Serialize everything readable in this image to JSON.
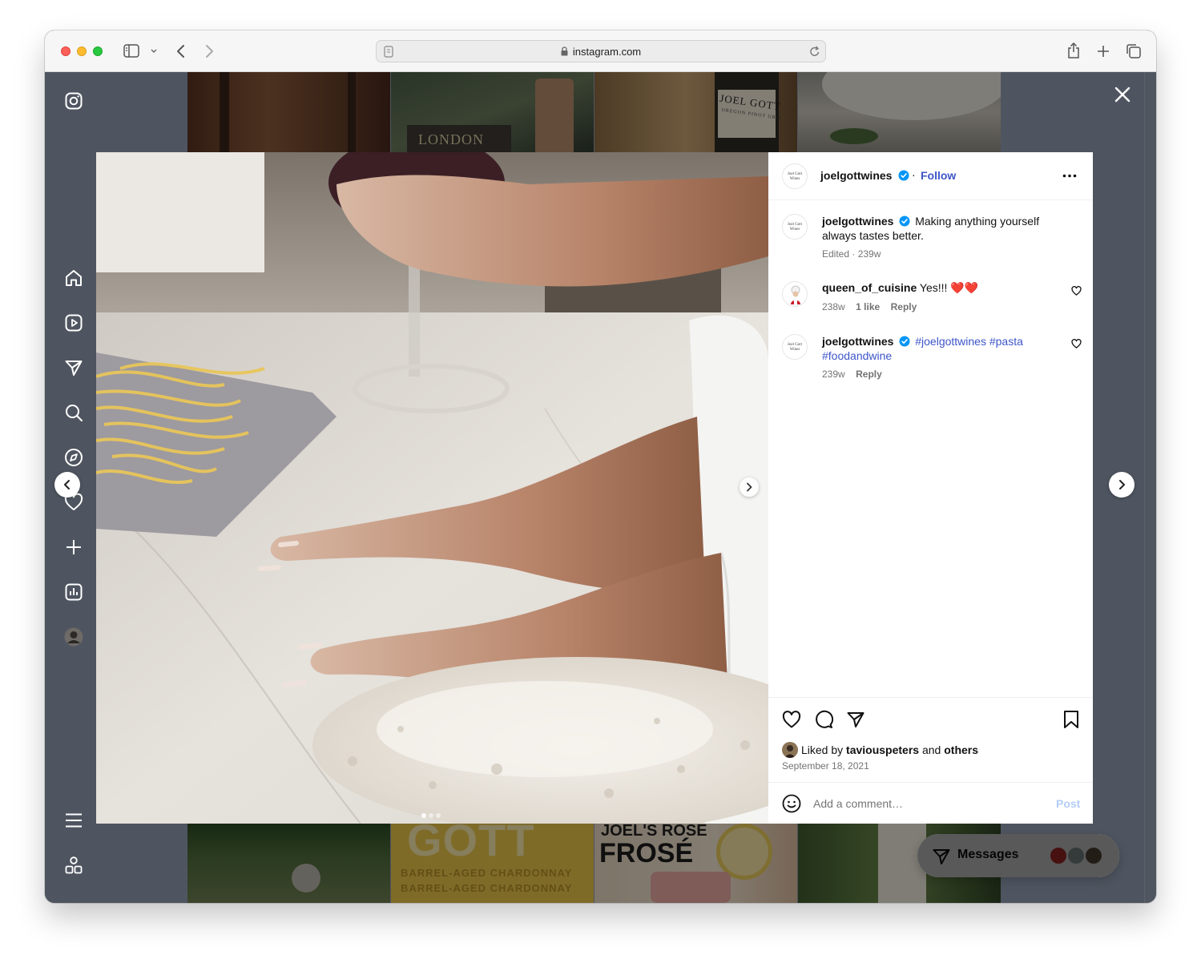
{
  "browser": {
    "url": "instagram.com"
  },
  "post": {
    "username": "joelgottwines",
    "follow_label": "Follow",
    "avatar_logo_text": "Joel Gott Wines",
    "caption": "Making anything yourself always tastes better.",
    "caption_line1": "Making anything yourself",
    "caption_line2": "always tastes better.",
    "caption_meta": "Edited · 239w",
    "image_page_count": 3,
    "image_page_current": 1
  },
  "comments": [
    {
      "username": "queen_of_cuisine",
      "text": "Yes!!! ❤️❤️",
      "age": "238w",
      "likes": "1 like",
      "reply_label": "Reply"
    },
    {
      "username": "joelgottwines",
      "hashtag1": "#joelgottwines",
      "hashtag2": "#pasta",
      "hashtag3": "#foodandwine",
      "age": "239w",
      "reply_label": "Reply"
    }
  ],
  "likes": {
    "prefix": "Liked by",
    "user": "taviouspeters",
    "and": "and",
    "others": "others",
    "date": "September 18, 2021"
  },
  "comment_input": {
    "placeholder": "Add a comment…",
    "post_label": "Post"
  },
  "messages": {
    "label": "Messages"
  },
  "thumbnails": {
    "london": "LONDON",
    "joel_gott": "JOEL GOTT",
    "pinot": "OREGON PINOT GRIS",
    "gott": "GOTT",
    "barrel": "BARREL-AGED CHARDONNAY",
    "joels_rose": "JOEL'S ROSÉ",
    "frose": "FROSÉ"
  },
  "colors": {
    "link_blue": "#3d55c9",
    "follow_blue": "#0095f6",
    "verified_blue": "#0095f6",
    "overlay": "#4f5560"
  }
}
